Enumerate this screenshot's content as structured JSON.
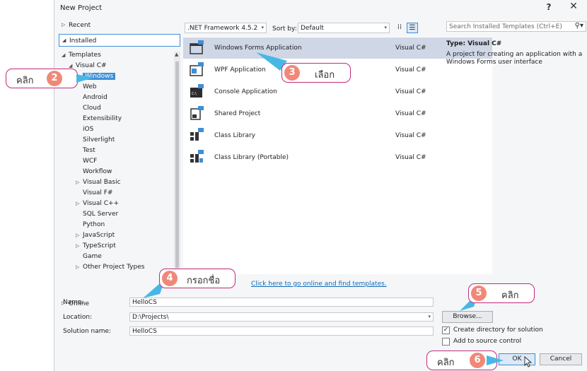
{
  "dialog": {
    "title": "New Project",
    "help_label": "?",
    "close_label": "✕"
  },
  "left": {
    "recent": "Recent",
    "installed": "Installed",
    "online": "Online",
    "tree": [
      {
        "label": "Templates",
        "arrow": "◢"
      },
      {
        "label": "Visual C#",
        "arrow": "◢"
      },
      {
        "label": "Windows",
        "arrow": "▷",
        "selected": true
      },
      {
        "label": "Web"
      },
      {
        "label": "Android"
      },
      {
        "label": "Cloud"
      },
      {
        "label": "Extensibility"
      },
      {
        "label": "iOS"
      },
      {
        "label": "Silverlight"
      },
      {
        "label": "Test"
      },
      {
        "label": "WCF"
      },
      {
        "label": "Workflow"
      },
      {
        "label": "Visual Basic",
        "arrow": "▷"
      },
      {
        "label": "Visual F#"
      },
      {
        "label": "Visual C++",
        "arrow": "▷"
      },
      {
        "label": "SQL Server"
      },
      {
        "label": "Python"
      },
      {
        "label": "JavaScript",
        "arrow": "▷"
      },
      {
        "label": "TypeScript",
        "arrow": "▷"
      },
      {
        "label": "Game"
      },
      {
        "label": "Other Project Types",
        "arrow": "▷"
      }
    ]
  },
  "toolbar": {
    "framework": ".NET Framework 4.5.2",
    "sort_label": "Sort by:",
    "sort_value": "Default",
    "search_placeholder": "Search Installed Templates (Ctrl+E)"
  },
  "templates": [
    {
      "name": "Windows Forms Application",
      "lang": "Visual C#",
      "icon": "windows-forms-icon",
      "selected": true
    },
    {
      "name": "WPF Application",
      "lang": "Visual C#",
      "icon": "wpf-icon"
    },
    {
      "name": "Console Application",
      "lang": "Visual C#",
      "icon": "console-icon"
    },
    {
      "name": "Shared Project",
      "lang": "Visual C#",
      "icon": "shared-project-icon"
    },
    {
      "name": "Class Library",
      "lang": "Visual C#",
      "icon": "class-library-icon"
    },
    {
      "name": "Class Library (Portable)",
      "lang": "Visual C#",
      "icon": "class-library-portable-icon"
    }
  ],
  "online_link": "Click here to go online and find templates.",
  "info": {
    "type_label": "Type:  Visual C#",
    "description": "A project for creating an application with a Windows Forms user interface"
  },
  "form": {
    "name_label": "Name:",
    "name_value": "HelloCS",
    "location_label": "Location:",
    "location_value": "D:\\Projects\\",
    "solution_label": "Solution name:",
    "solution_value": "HelloCS",
    "browse": "Browse...",
    "create_dir": "Create directory for solution",
    "create_dir_checked": true,
    "source_control": "Add to source control",
    "source_control_checked": false,
    "ok": "OK",
    "cancel": "Cancel"
  },
  "annotations": {
    "step2": {
      "num": "2",
      "text": "คลิก"
    },
    "step3": {
      "num": "3",
      "text": "เลือก"
    },
    "step4": {
      "num": "4",
      "text": "กรอกชื่อ"
    },
    "step5": {
      "num": "5",
      "text": "คลิก"
    },
    "step6": {
      "num": "6",
      "text": "คลิก"
    },
    "accent": "#c12a7b",
    "badge_color": "#f08878",
    "arrow_color": "#47b8e6"
  }
}
